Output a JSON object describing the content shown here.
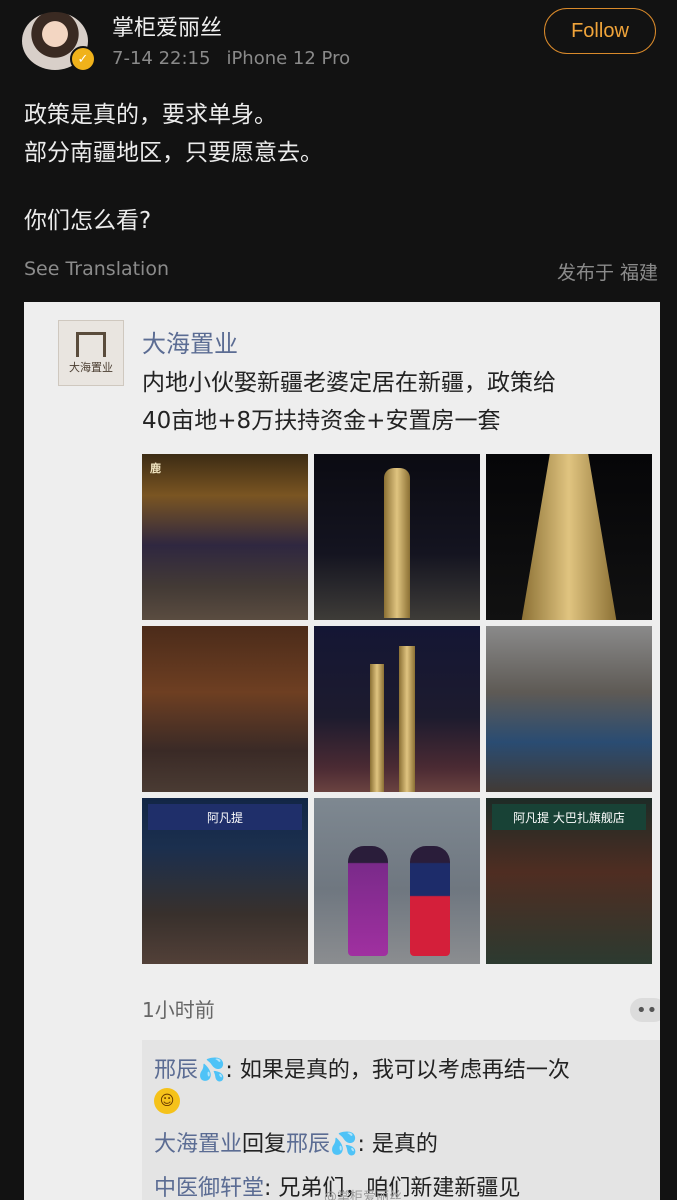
{
  "post": {
    "author": "掌柜爱丽丝",
    "time": "7-14 22:15",
    "device": "iPhone 12 Pro",
    "follow_label": "Follow",
    "text": {
      "line1": "政策是真的，要求单身。",
      "line2": "部分南疆地区，只要愿意去。",
      "line3": "你们怎么看?"
    },
    "see_translation": "See Translation",
    "location": "发布于 福建",
    "colors": {
      "accent": "#f0a43a",
      "background": "#121212"
    }
  },
  "screenshot": {
    "logo_text": "大海置业",
    "logo_mark": "DH",
    "business_name": "大海置业",
    "body_line1": "内地小伙娶新疆老婆定居在新疆，政策给",
    "body_line2": "40亩地+8万扶持资金+安置房一套",
    "photos": {
      "p1_label": "鹿",
      "p7_sign": "阿凡提",
      "p9_sign": "阿凡提  大巴扎旗舰店"
    },
    "time_ago": "1小时前",
    "more_icon": "more-dots-icon",
    "comments": {
      "c1_name": "邢辰",
      "c1_text": "如果是真的，我可以考虑再结一次",
      "c2_name": "大海置业",
      "c2_reply": "回复",
      "c2_target": "邢辰",
      "c2_text": "是真的",
      "c3_name": "中医御轩堂",
      "c3_text": ": 兄弟们，咱们新建新疆见"
    },
    "watermark": "@掌柜爱丽丝"
  }
}
